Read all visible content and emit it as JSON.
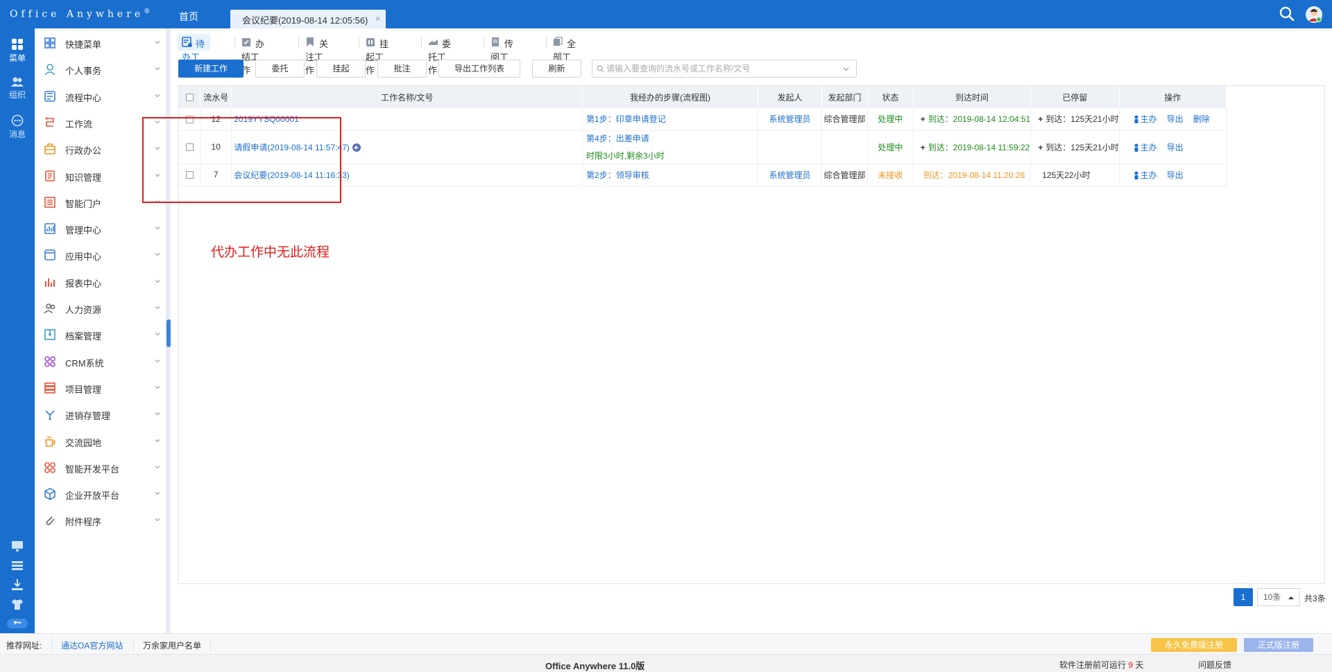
{
  "app": {
    "logo_text": "Office Anywhere",
    "logo_reg": "®",
    "home_tab": "首页",
    "active_tab": "会议纪要(2019-08-14 12:05:56)",
    "tab_close": "×"
  },
  "rail": [
    {
      "label": "菜单",
      "icon": "grid-icon"
    },
    {
      "label": "组织",
      "icon": "people-icon"
    },
    {
      "label": "消息",
      "icon": "chat-icon"
    }
  ],
  "rail_pill": "▾━",
  "menu": [
    {
      "label": "快捷菜单",
      "icon": "shortcut-icon",
      "color": "#3a7fd5"
    },
    {
      "label": "个人事务",
      "icon": "person-icon",
      "color": "#3aa0c8"
    },
    {
      "label": "流程中心",
      "icon": "flow-icon",
      "color": "#3a7fd5"
    },
    {
      "label": "工作流",
      "icon": "workflow-icon",
      "color": "#e8543a"
    },
    {
      "label": "行政办公",
      "icon": "briefcase-icon",
      "color": "#f0941e"
    },
    {
      "label": "知识管理",
      "icon": "book-icon",
      "color": "#e8543a"
    },
    {
      "label": "智能门户",
      "icon": "portal-icon",
      "color": "#e8543a"
    },
    {
      "label": "管理中心",
      "icon": "chart-icon",
      "color": "#3a7fd5"
    },
    {
      "label": "应用中心",
      "icon": "app-icon",
      "color": "#3a7fd5"
    },
    {
      "label": "报表中心",
      "icon": "bar-chart-icon",
      "color": "#e8543a"
    },
    {
      "label": "人力资源",
      "icon": "users-icon",
      "color": "#666666"
    },
    {
      "label": "档案管理",
      "icon": "archive-icon",
      "color": "#3aa0c8"
    },
    {
      "label": "CRM系统",
      "icon": "crm-icon",
      "color": "#a04ad8"
    },
    {
      "label": "项目管理",
      "icon": "project-icon",
      "color": "#e8543a"
    },
    {
      "label": "进销存管理",
      "icon": "inventory-icon",
      "color": "#3a7fd5"
    },
    {
      "label": "交流园地",
      "icon": "coffee-icon",
      "color": "#f0941e"
    },
    {
      "label": "智能开发平台",
      "icon": "dev-icon",
      "color": "#e8543a"
    },
    {
      "label": "企业开放平台",
      "icon": "cube-icon",
      "color": "#3a7fd5"
    },
    {
      "label": "附件程序",
      "icon": "attachment-icon",
      "color": "#666666"
    }
  ],
  "work_tabs": [
    {
      "label": "待办工作",
      "icon": "todo-icon",
      "active": true
    },
    {
      "label": "办结工作",
      "icon": "done-icon"
    },
    {
      "label": "关注工作",
      "icon": "bookmark-icon"
    },
    {
      "label": "挂起工作",
      "icon": "pause-icon"
    },
    {
      "label": "委托工作",
      "icon": "delegate-icon"
    },
    {
      "label": "传阅工作",
      "icon": "circulate-icon"
    },
    {
      "label": "全部工作",
      "icon": "all-icon"
    }
  ],
  "toolbar": {
    "new_work": "新建工作",
    "delegate": "委托",
    "suspend": "挂起",
    "comment": "批注",
    "export_list": "导出工作列表",
    "refresh": "刷新",
    "search_placeholder": "请输入要查询的流水号或工作名称/文号"
  },
  "table": {
    "headers": [
      "",
      "流水号",
      "工作名称/文号",
      "我经办的步骤(流程图)",
      "发起人",
      "发起部门",
      "状态",
      "到达时间",
      "已停留",
      "操作"
    ],
    "rows": [
      {
        "no": "12",
        "name": "2019YYSQ00001",
        "step": "第1步：印章申请登记",
        "step_extra": "",
        "initiator": "系统管理员",
        "dept": "综合管理部",
        "status": "处理中",
        "arrive": "到达：2019-08-14 12:04:51",
        "stay": "到达：125天21小时",
        "ops": [
          "主办",
          "导出",
          "删除"
        ]
      },
      {
        "no": "10",
        "name": "请假申请(2019-08-14 11:57:47)",
        "step": "第4步：出差申请",
        "step_extra": "时限3小时,剩余3小时",
        "initiator": "",
        "dept": "",
        "status": "处理中",
        "arrive": "到达：2019-08-14 11:59:22",
        "stay": "到达：125天21小时",
        "ops": [
          "主办",
          "导出"
        ]
      },
      {
        "no": "7",
        "name": "会议纪要(2019-08-14 11:16:33)",
        "step": "第2步：领导审核",
        "step_extra": "",
        "initiator": "系统管理员",
        "dept": "综合管理部",
        "status": "未接收",
        "arrive": "到达：2019-08-14 11:20:26",
        "stay": "125天22小时",
        "ops": [
          "主办",
          "导出"
        ]
      }
    ]
  },
  "annotation": "代办工作中无此流程",
  "pager": {
    "current": "1",
    "page_size": "10条",
    "total": "共3条"
  },
  "footer": {
    "recommend_label": "推荐网址:",
    "site_link": "通达OA官方网站",
    "users_link": "万余家用户名单",
    "free_reg": "永久免费版注册",
    "formal_reg": "正式版注册",
    "version": "Office Anywhere 11.0版",
    "trial_prefix": "软件注册前可运行",
    "trial_days": "9",
    "trial_suffix": "天",
    "feedback": "问题反馈"
  },
  "colors": {
    "brand": "#1a6fce",
    "status_processing": "#1d8a1d",
    "status_unreceived": "#f0941e",
    "annotation_red": "#e31b1b",
    "free_reg_bg": "#f7c447",
    "formal_reg_bg": "#9bb4ec"
  }
}
